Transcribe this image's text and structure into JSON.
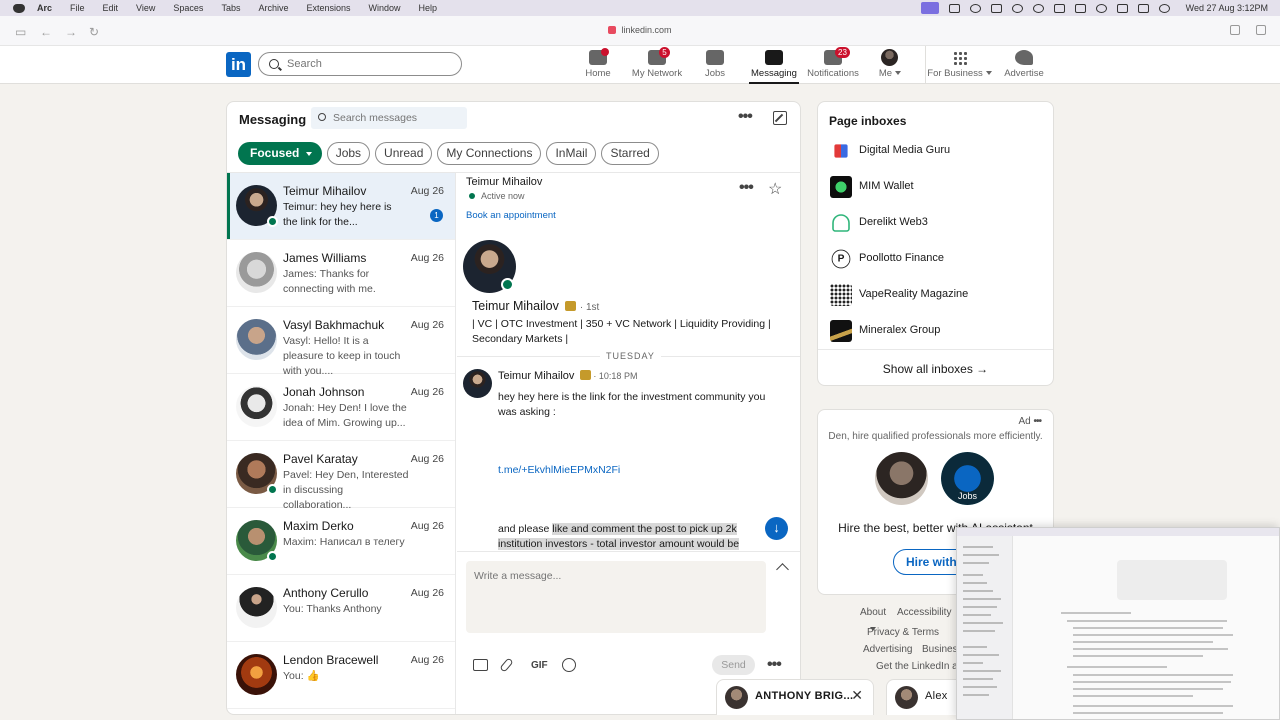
{
  "os_menubar": {
    "app": "Arc",
    "items": [
      "File",
      "Edit",
      "View",
      "Spaces",
      "Tabs",
      "Archive",
      "Extensions",
      "Window",
      "Help"
    ],
    "clock": "Wed 27 Aug  3:12PM"
  },
  "browser": {
    "url": "linkedin.com"
  },
  "header": {
    "logo": "in",
    "search_placeholder": "Search",
    "nav": [
      {
        "label": "Home",
        "badge": ""
      },
      {
        "label": "My Network",
        "badge": "5"
      },
      {
        "label": "Jobs",
        "badge": ""
      },
      {
        "label": "Messaging",
        "badge": ""
      },
      {
        "label": "Notifications",
        "badge": "23"
      },
      {
        "label": "Me",
        "badge": ""
      },
      {
        "label": "For Business",
        "badge": ""
      },
      {
        "label": "Advertise",
        "badge": ""
      }
    ]
  },
  "messaging": {
    "title": "Messaging",
    "search_placeholder": "Search messages",
    "filters": [
      "Focused",
      "Jobs",
      "Unread",
      "My Connections",
      "InMail",
      "Starred"
    ],
    "conversations": [
      {
        "name": "Teimur Mihailov",
        "date": "Aug 26",
        "preview": "Teimur: hey hey here is the link for the...",
        "unread": "1",
        "online": true
      },
      {
        "name": "James Williams",
        "date": "Aug 26",
        "preview": "James: Thanks for connecting with me.",
        "unread": "",
        "online": false
      },
      {
        "name": "Vasyl Bakhmachuk",
        "date": "Aug 26",
        "preview": "Vasyl: Hello! It is a pleasure to keep in touch with you....",
        "unread": "",
        "online": false
      },
      {
        "name": "Jonah Johnson",
        "date": "Aug 26",
        "preview": "Jonah: Hey Den! I love the idea of Mim. Growing up...",
        "unread": "",
        "online": false
      },
      {
        "name": "Pavel Karatay",
        "date": "Aug 26",
        "preview": "Pavel: Hey Den, Interested in discussing collaboration...",
        "unread": "",
        "online": true
      },
      {
        "name": "Maxim Derko",
        "date": "Aug 26",
        "preview": "Maxim: Написал в телегу",
        "unread": "",
        "online": true
      },
      {
        "name": "Anthony Cerullo",
        "date": "Aug 26",
        "preview": "You: Thanks Anthony",
        "unread": "",
        "online": false
      },
      {
        "name": "Lendon Bracewell",
        "date": "Aug 26",
        "preview": "You: 👍",
        "unread": "",
        "online": false
      }
    ]
  },
  "thread": {
    "name": "Teimur Mihailov",
    "status": "Active now",
    "book_link": "Book an appointment",
    "profile_name": "Teimur Mihailov",
    "degree": "· 1st",
    "headline": "| VC | OTC Investment | 350 + VC Network | Liquidity Providing | Secondary Markets |",
    "day": "TUESDAY",
    "sender": "Teimur Mihailov",
    "time": "· 10:18 PM",
    "message1": "hey hey here is the link for the investment community you was asking :",
    "link": "t.me/+EkvhlMieEPMxN2Fi",
    "message2_a": "and please ",
    "message2_b": "like and comment the post to pick up 2k institution investors - total investor amount would be",
    "compose_placeholder": "Write a message...",
    "gif_label": "GIF",
    "send_label": "Send",
    "scroll_icon": "↓"
  },
  "page_inboxes": {
    "title": "Page inboxes",
    "items": [
      {
        "name": "Digital Media Guru",
        "color": "#ffffff"
      },
      {
        "name": "MIM Wallet",
        "color": "#0d0d0d"
      },
      {
        "name": "Derelikt Web3",
        "color": "#2fb57a"
      },
      {
        "name": "Poollotto Finance",
        "color": "#ffffff"
      },
      {
        "name": "VapeReality Magazine",
        "color": "#ffffff"
      },
      {
        "name": "Mineralex Group",
        "color": "#111111"
      }
    ],
    "show_all": "Show all inboxes →"
  },
  "ad": {
    "label": "Ad",
    "text": "Den, hire qualified professionals more efficiently.",
    "jobs_label": "Jobs",
    "headline": "Hire the best, better with AI assistant",
    "button": "Hire with"
  },
  "footer": {
    "links": [
      "About",
      "Accessibility",
      "Privacy & Terms",
      "Advertising",
      "Busines",
      "Get the LinkedIn ap"
    ]
  },
  "chat_bubbles": [
    {
      "name": "ANTHONY BRIG..."
    },
    {
      "name": "Alex"
    }
  ],
  "colors": {
    "brand": "#0a66c2",
    "focused_chip": "#01754f",
    "badge": "#cb112d"
  }
}
